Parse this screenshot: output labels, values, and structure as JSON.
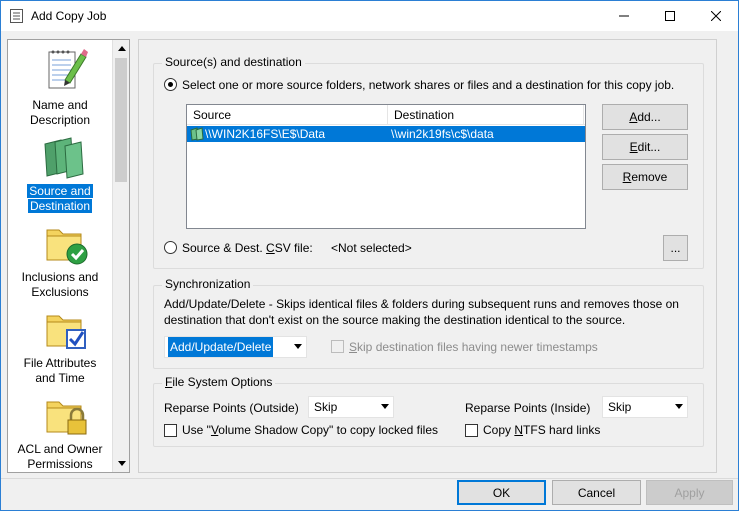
{
  "window": {
    "title": "Add Copy Job"
  },
  "nav": {
    "items": [
      {
        "label_line1": "Name and",
        "label_line2": "Description",
        "icon": "notepad-pencil-icon",
        "selected": false
      },
      {
        "label_line1": "Source and",
        "label_line2": "Destination",
        "icon": "source-destination-icon",
        "selected": true
      },
      {
        "label_line1": "Inclusions and",
        "label_line2": "Exclusions",
        "icon": "folder-check-icon",
        "selected": false
      },
      {
        "label_line1": "File Attributes",
        "label_line2": "and Time",
        "icon": "folder-checkbox-icon",
        "selected": false
      },
      {
        "label_line1": "ACL and Owner",
        "label_line2": "Permissions",
        "icon": "folder-lock-icon",
        "selected": false
      }
    ]
  },
  "source_dest": {
    "group_title": "Source(s) and destination",
    "radio_select_label": "Select one or more source folders, network shares or files and a destination for this copy job.",
    "columns": [
      "Source",
      "Destination"
    ],
    "rows": [
      {
        "source": "\\\\WIN2K16FS\\E$\\Data",
        "destination": "\\\\win2k19fs\\c$\\data"
      }
    ],
    "add_pre": "",
    "add_u": "A",
    "add_post": "dd...",
    "edit_pre": "",
    "edit_u": "E",
    "edit_post": "dit...",
    "remove_pre": "",
    "remove_u": "R",
    "remove_post": "emove",
    "csv_pre": "Source & Dest. ",
    "csv_u": "C",
    "csv_post": "SV file:",
    "csv_value": "<Not selected>",
    "browse_label": "..."
  },
  "sync": {
    "group_title": "Synchronization",
    "description_line1": "Add/Update/Delete - Skips identical files & folders during subsequent runs and removes those on",
    "description_line2": "destination that don't exist on the source making the destination identical to the source.",
    "mode_value": "Add/Update/Delete",
    "skip_u": "S",
    "skip_post": "kip destination files having newer timestamps"
  },
  "fso": {
    "group_title_u": "F",
    "group_title_post": "ile System Options",
    "reparse_outside_label": "Reparse Points (Outside)",
    "reparse_outside_value": "Skip",
    "reparse_inside_label": "Reparse Points (Inside)",
    "reparse_inside_value": "Skip",
    "vss_pre": "Use \"",
    "vss_u": "V",
    "vss_post": "olume Shadow Copy\" to copy locked files",
    "hardlinks_pre": "Copy ",
    "hardlinks_u": "N",
    "hardlinks_post": "TFS hard links"
  },
  "footer": {
    "ok_label": "OK",
    "cancel_label": "Cancel",
    "apply_label": "Apply"
  }
}
